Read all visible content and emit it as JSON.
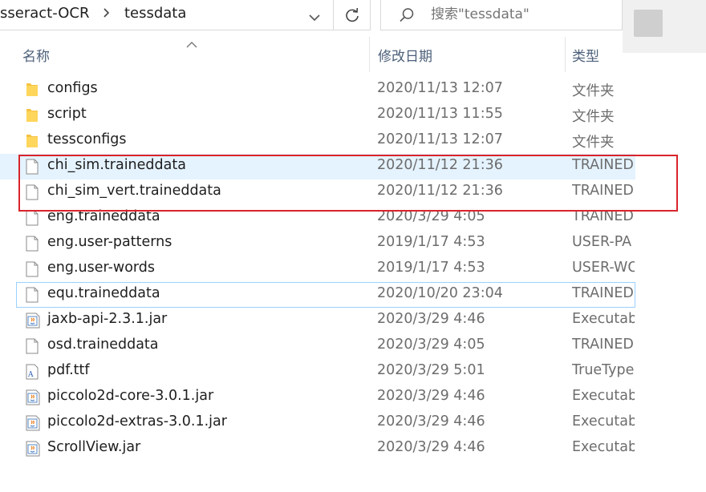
{
  "address": {
    "crumbs": [
      "sseract-OCR",
      "tessdata"
    ]
  },
  "search": {
    "placeholder": "搜索\"tessdata\""
  },
  "columns": {
    "name": "名称",
    "date": "修改日期",
    "type": "类型"
  },
  "files": [
    {
      "name": "configs",
      "date": "2020/11/13 12:07",
      "type": "文件夹",
      "icon": "folder-icon"
    },
    {
      "name": "script",
      "date": "2020/11/13 11:55",
      "type": "文件夹",
      "icon": "folder-icon"
    },
    {
      "name": "tessconfigs",
      "date": "2020/11/13 12:07",
      "type": "文件夹",
      "icon": "folder-icon"
    },
    {
      "name": "chi_sim.traineddata",
      "date": "2020/11/12 21:36",
      "type": "TRAINED",
      "icon": "file-icon",
      "selected": true
    },
    {
      "name": "chi_sim_vert.traineddata",
      "date": "2020/11/12 21:36",
      "type": "TRAINED",
      "icon": "file-icon"
    },
    {
      "name": "eng.traineddata",
      "date": "2020/3/29 4:05",
      "type": "TRAINED",
      "icon": "file-icon"
    },
    {
      "name": "eng.user-patterns",
      "date": "2019/1/17 4:53",
      "type": "USER-PA",
      "icon": "file-icon"
    },
    {
      "name": "eng.user-words",
      "date": "2019/1/17 4:53",
      "type": "USER-WO",
      "icon": "file-icon"
    },
    {
      "name": "equ.traineddata",
      "date": "2020/10/20 23:04",
      "type": "TRAINED",
      "icon": "file-icon",
      "focused": true
    },
    {
      "name": "jaxb-api-2.3.1.jar",
      "date": "2020/3/29 4:46",
      "type": "Executab",
      "icon": "java-jar-icon"
    },
    {
      "name": "osd.traineddata",
      "date": "2020/3/29 4:05",
      "type": "TRAINED",
      "icon": "file-icon"
    },
    {
      "name": "pdf.ttf",
      "date": "2020/3/29 5:01",
      "type": "TrueType",
      "icon": "font-file-icon"
    },
    {
      "name": "piccolo2d-core-3.0.1.jar",
      "date": "2020/3/29 4:46",
      "type": "Executab",
      "icon": "java-jar-icon"
    },
    {
      "name": "piccolo2d-extras-3.0.1.jar",
      "date": "2020/3/29 4:46",
      "type": "Executab",
      "icon": "java-jar-icon"
    },
    {
      "name": "ScrollView.jar",
      "date": "2020/3/29 4:46",
      "type": "Executab",
      "icon": "java-jar-icon"
    }
  ],
  "colors": {
    "highlight": "#d9242b",
    "selection": "#e5f3ff",
    "header_text": "#4c607a"
  }
}
